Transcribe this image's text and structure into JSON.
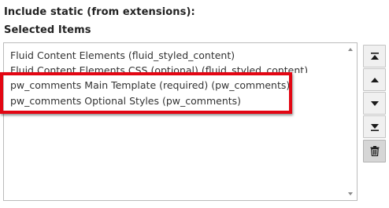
{
  "form": {
    "include_static_label": "Include static (from extensions):",
    "selected_items_label": "Selected Items"
  },
  "selected_items": [
    "Fluid Content Elements (fluid_styled_content)",
    "Fluid Content Elements CSS (optional) (fluid_styled_content)",
    "pw_comments Main Template (required) (pw_comments)",
    "pw_comments Optional Styles (pw_comments)"
  ],
  "controls": {
    "icons": [
      "move-to-top-icon",
      "move-up-icon",
      "move-down-icon",
      "move-to-bottom-icon",
      "trash-icon"
    ]
  },
  "colors": {
    "highlight": "#e30613",
    "button_bg": "#f0f0f0",
    "delete_button_bg": "#d6d6d6"
  }
}
